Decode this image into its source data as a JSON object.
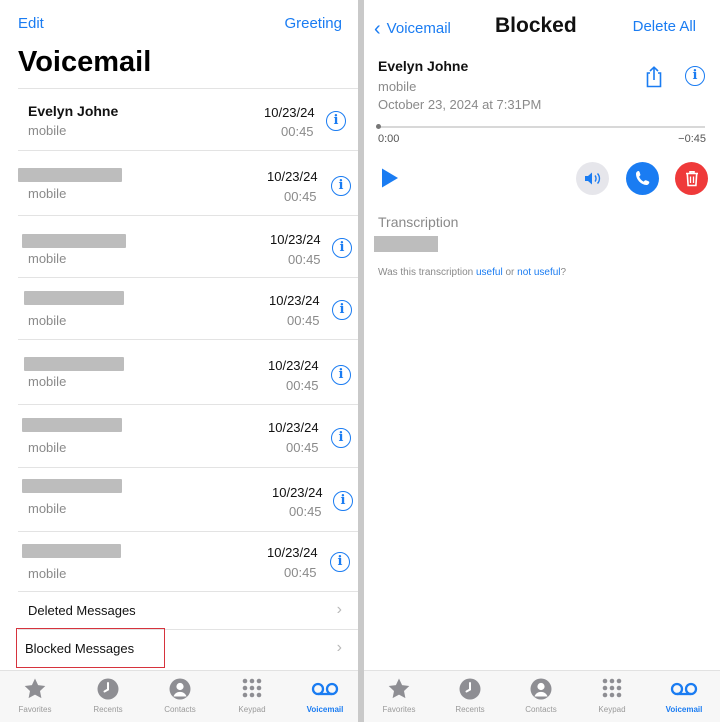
{
  "left": {
    "edit_label": "Edit",
    "greeting_label": "Greeting",
    "title": "Voicemail",
    "voicemails": [
      {
        "name": "Evelyn Johne",
        "label": "mobile",
        "date": "10/23/24",
        "duration": "00:45"
      },
      {
        "name": "",
        "label": "mobile",
        "date": "10/23/24",
        "duration": "00:45"
      },
      {
        "name": "",
        "label": "mobile",
        "date": "10/23/24",
        "duration": "00:45"
      },
      {
        "name": "",
        "label": "mobile",
        "date": "10/23/24",
        "duration": "00:45"
      },
      {
        "name": "",
        "label": "mobile",
        "date": "10/23/24",
        "duration": "00:45"
      },
      {
        "name": "",
        "label": "mobile",
        "date": "10/23/24",
        "duration": "00:45"
      },
      {
        "name": "",
        "label": "mobile",
        "date": "10/23/24",
        "duration": "00:45"
      },
      {
        "name": "",
        "label": "mobile",
        "date": "10/23/24",
        "duration": "00:45"
      }
    ],
    "deleted_label": "Deleted Messages",
    "blocked_label": "Blocked Messages"
  },
  "tabs": [
    {
      "label": "Favorites",
      "icon": "star-icon"
    },
    {
      "label": "Recents",
      "icon": "clock-icon"
    },
    {
      "label": "Contacts",
      "icon": "person-icon"
    },
    {
      "label": "Keypad",
      "icon": "keypad-icon"
    },
    {
      "label": "Voicemail",
      "icon": "voicemail-icon",
      "active": true
    }
  ],
  "right": {
    "back_label": "Voicemail",
    "title": "Blocked",
    "delete_all_label": "Delete All",
    "detail": {
      "name": "Evelyn Johne",
      "label": "mobile",
      "datetime": "October 23, 2024 at 7:31PM"
    },
    "playback": {
      "elapsed": "0:00",
      "remaining": "−0:45",
      "progress": 0
    },
    "transcription_title": "Transcription",
    "feedback": {
      "prefix": "Was this transcription",
      "useful": "useful",
      "or": "or",
      "not_useful": "not useful",
      "suffix": "?"
    }
  },
  "colors": {
    "accent": "#1a7cf2",
    "danger": "#ef3a3a",
    "highlight_box": "#d6333d"
  }
}
